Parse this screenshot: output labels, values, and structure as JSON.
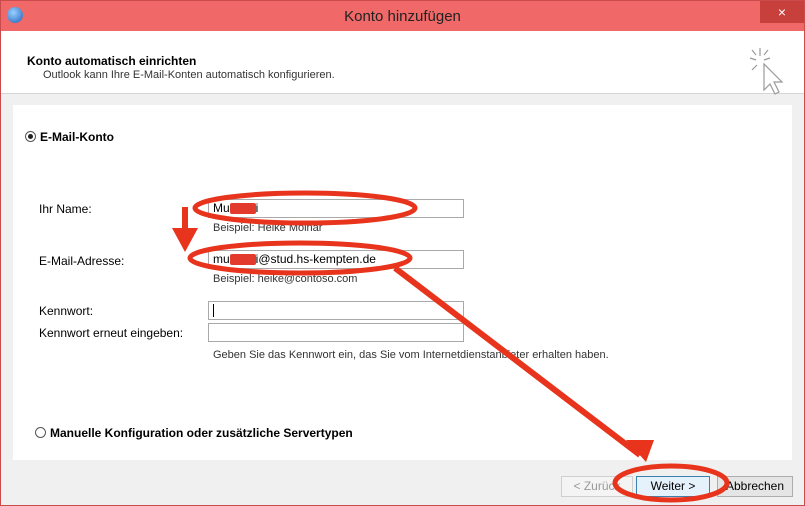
{
  "window": {
    "title": "Konto hinzufügen",
    "close_label": "×"
  },
  "header": {
    "title": "Konto automatisch einrichten",
    "subtitle": "Outlook kann Ihre E-Mail-Konten automatisch konfigurieren."
  },
  "form": {
    "email_account_label": "E-Mail-Konto",
    "name_label": "Ihr Name:",
    "name_value_prefix": "Mu",
    "name_value_suffix": "i",
    "name_example": "Beispiel: Heike Molnar",
    "email_label": "E-Mail-Adresse:",
    "email_value_prefix": "mu",
    "email_value_suffix": "i@stud.hs-kempten.de",
    "email_example": "Beispiel: heike@contoso.com",
    "password_label": "Kennwort:",
    "password_value": "",
    "password_repeat_label": "Kennwort erneut eingeben:",
    "password_repeat_value": "",
    "password_hint": "Geben Sie das Kennwort ein, das Sie vom Internetdienstanbieter erhalten haben.",
    "manual_config_label": "Manuelle Konfiguration oder zusätzliche Servertypen",
    "selected_option": "E-Mail-Konto"
  },
  "buttons": {
    "back_label": "< Zurück",
    "next_label": "Weiter >",
    "cancel_label": "Abbrechen"
  },
  "annotations": {
    "color": "#e8341c"
  }
}
